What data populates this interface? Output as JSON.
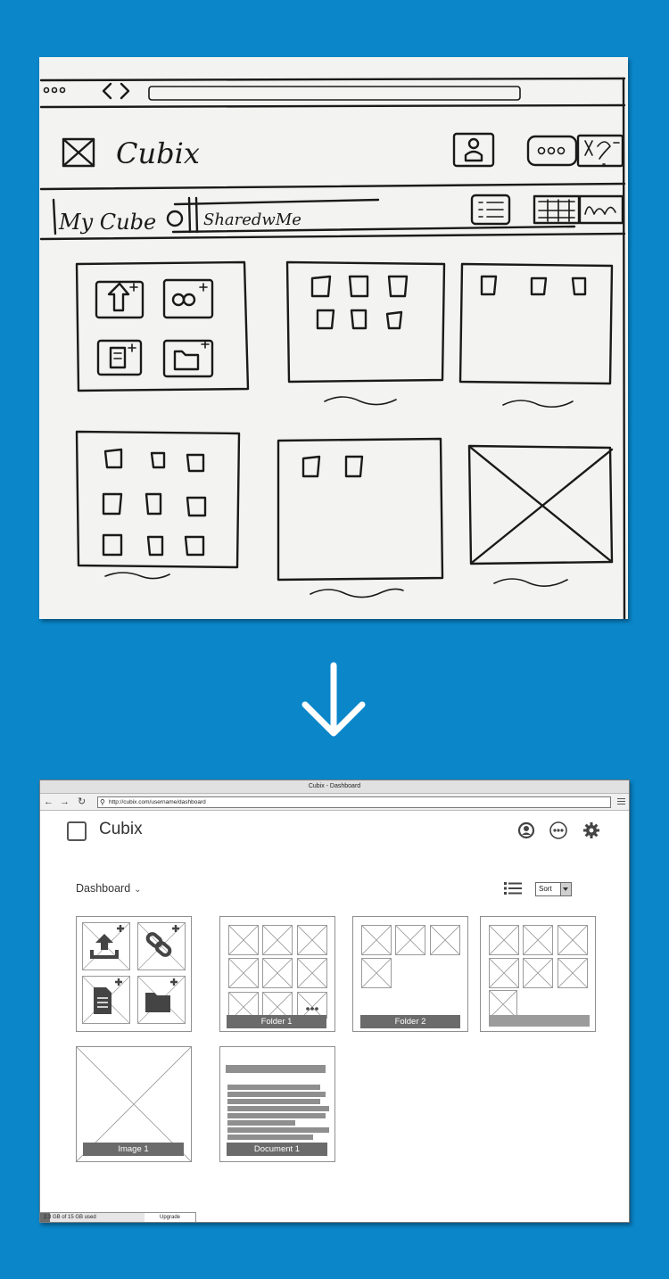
{
  "sketch": {
    "logo_text": "Cubix",
    "tab_my_cube": "My Cube",
    "tab_shared": "SharedwMe"
  },
  "wireframe": {
    "window_title": "Cubix - Dashboard",
    "url": "http://cubix.com/username/dashboard",
    "app_name": "Cubix",
    "view_label": "Dashboard",
    "sort_label": "Sort",
    "icons": {
      "user": "user-circle-icon",
      "more": "ellipsis-circle-icon",
      "settings": "gear-icon",
      "list": "list-view-icon",
      "upload": "upload-icon",
      "link": "add-link-icon",
      "doc": "add-document-icon",
      "folder": "add-folder-icon"
    },
    "tiles": {
      "folder1": "Folder 1",
      "folder2": "Folder 2",
      "image1": "Image 1",
      "document1": "Document 1"
    },
    "status": {
      "storage_text": "2.3 GB of 15 GB used",
      "upgrade": "Upgrade"
    },
    "colors": {
      "background": "#0a86c9",
      "caption": "#6b6b6b"
    }
  }
}
